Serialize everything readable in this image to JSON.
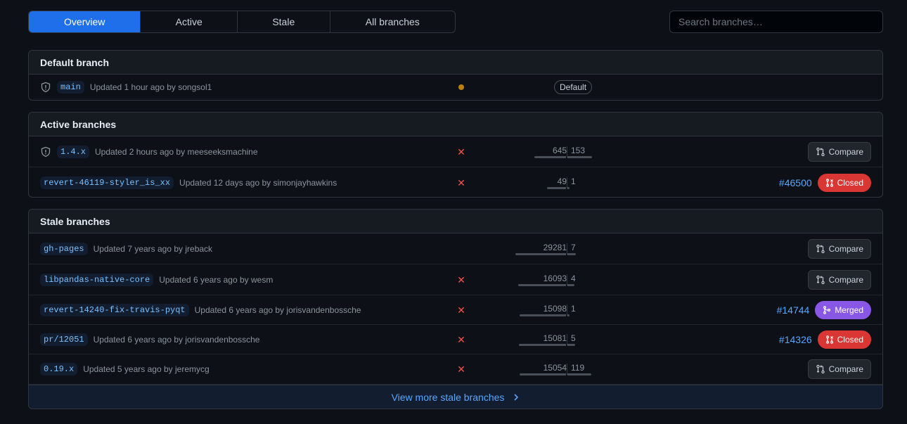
{
  "tabs": [
    {
      "label": "Overview",
      "selected": true
    },
    {
      "label": "Active",
      "selected": false
    },
    {
      "label": "Stale",
      "selected": false
    },
    {
      "label": "All branches",
      "selected": false
    }
  ],
  "search": {
    "placeholder": "Search branches…"
  },
  "default_section": {
    "title": "Default branch",
    "rows": [
      {
        "branch": "main",
        "updated": "Updated 1 hour ago by",
        "author": "songsol1",
        "protected": true,
        "status": "pending",
        "badge": "Default"
      }
    ]
  },
  "active_section": {
    "title": "Active branches",
    "rows": [
      {
        "branch": "1.4.x",
        "updated": "Updated 2 hours ago by",
        "author": "meeseeksmachine",
        "protected": true,
        "status": "failed",
        "behind": "645",
        "ahead": "153",
        "action": "Compare"
      },
      {
        "branch": "revert-46119-styler_is_xx",
        "updated": "Updated 12 days ago by",
        "author": "simonjayhawkins",
        "protected": false,
        "status": "failed",
        "behind": "49",
        "ahead": "1",
        "pr": "#46500",
        "action": "Closed"
      }
    ]
  },
  "stale_section": {
    "title": "Stale branches",
    "rows": [
      {
        "branch": "gh-pages",
        "updated": "Updated 7 years ago by",
        "author": "jreback",
        "status": "none",
        "behind": "29281",
        "ahead": "7",
        "action": "Compare"
      },
      {
        "branch": "libpandas-native-core",
        "updated": "Updated 6 years ago by",
        "author": "wesm",
        "status": "failed",
        "behind": "16093",
        "ahead": "4",
        "action": "Compare"
      },
      {
        "branch": "revert-14240-fix-travis-pyqt",
        "updated": "Updated 6 years ago by",
        "author": "jorisvandenbossche",
        "status": "failed",
        "behind": "15098",
        "ahead": "1",
        "pr": "#14744",
        "action": "Merged"
      },
      {
        "branch": "pr/12051",
        "updated": "Updated 6 years ago by",
        "author": "jorisvandenbossche",
        "status": "failed",
        "behind": "15081",
        "ahead": "5",
        "pr": "#14326",
        "action": "Closed"
      },
      {
        "branch": "0.19.x",
        "updated": "Updated 5 years ago by",
        "author": "jeremycg",
        "status": "failed",
        "behind": "15054",
        "ahead": "119",
        "action": "Compare"
      }
    ],
    "view_more": "View more stale branches"
  },
  "colors": {
    "accent": "#1f6feb",
    "link": "#58a6ff",
    "closed": "#da3633",
    "merged": "#8957e5",
    "failed": "#f85149",
    "pending": "#bb8009"
  }
}
